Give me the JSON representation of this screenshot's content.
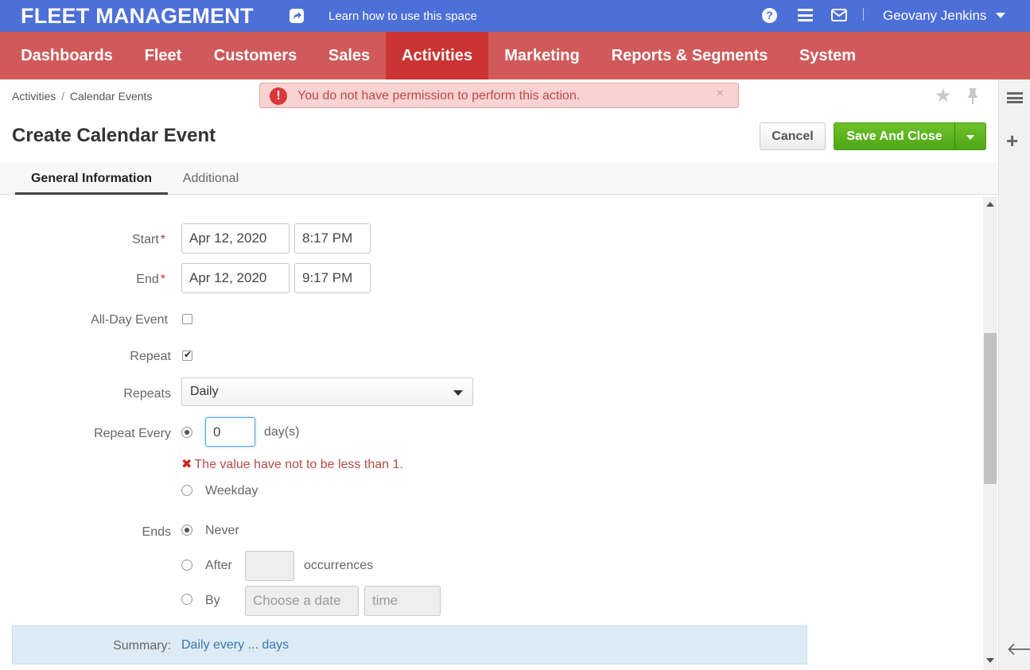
{
  "header": {
    "brand": "FLEET MANAGEMENT",
    "learn_link": "Learn how to use this space",
    "help_icon": "?",
    "user_name": "Geovany Jenkins"
  },
  "nav": {
    "items": [
      {
        "label": "Dashboards"
      },
      {
        "label": "Fleet"
      },
      {
        "label": "Customers"
      },
      {
        "label": "Sales"
      },
      {
        "label": "Activities",
        "active": true
      },
      {
        "label": "Marketing"
      },
      {
        "label": "Reports & Segments"
      },
      {
        "label": "System"
      }
    ]
  },
  "breadcrumb": {
    "parent": "Activities",
    "separator": "/",
    "current": "Calendar Events"
  },
  "alert": {
    "icon": "!",
    "message": "You do not have permission to perform this action.",
    "close": "×"
  },
  "page": {
    "title": "Create Calendar Event",
    "cancel_label": "Cancel",
    "save_label": "Save And Close"
  },
  "tabs": [
    {
      "label": "General Information",
      "active": true
    },
    {
      "label": "Additional"
    }
  ],
  "form": {
    "start_label": "Start",
    "start_date": "Apr 12, 2020",
    "start_time": "8:17 PM",
    "end_label": "End",
    "end_date": "Apr 12, 2020",
    "end_time": "9:17 PM",
    "required_mark": "*",
    "allday_label": "All-Day Event",
    "allday_checked": false,
    "repeat_label": "Repeat",
    "repeat_checked": true,
    "repeats_label": "Repeats",
    "repeats_value": "Daily",
    "repeat_every_label": "Repeat Every",
    "repeat_every_value": "0",
    "repeat_every_unit": "day(s)",
    "error_icon": "✖",
    "error_message": "The value have not to be less than 1.",
    "weekday_label": "Weekday",
    "ends_label": "Ends",
    "ends_never": "Never",
    "ends_after": "After",
    "ends_after_value": "",
    "ends_occurrences": "occurrences",
    "ends_by": "By",
    "ends_by_date_placeholder": "Choose a date",
    "ends_by_time_placeholder": "time",
    "summary_label": "Summary:",
    "summary_value": "Daily every ... days"
  },
  "colors": {
    "topbar": "#4d6fd8",
    "nav": "#d05a5a",
    "nav_active": "#cc3333",
    "save_button": "#5ab31f",
    "alert_bg": "#f9d2d2",
    "summary_bg": "#dcebf5"
  },
  "icons": {
    "share": "share-icon",
    "help": "question-circle-icon",
    "menu": "hamburger-icon",
    "mail": "envelope-icon",
    "user_caret": "caret-down-icon",
    "star": "star-icon",
    "pin": "pin-icon",
    "sidebar_list": "list-icon",
    "sidebar_plus": "plus-icon",
    "sidebar_back": "arrow-left-icon"
  }
}
